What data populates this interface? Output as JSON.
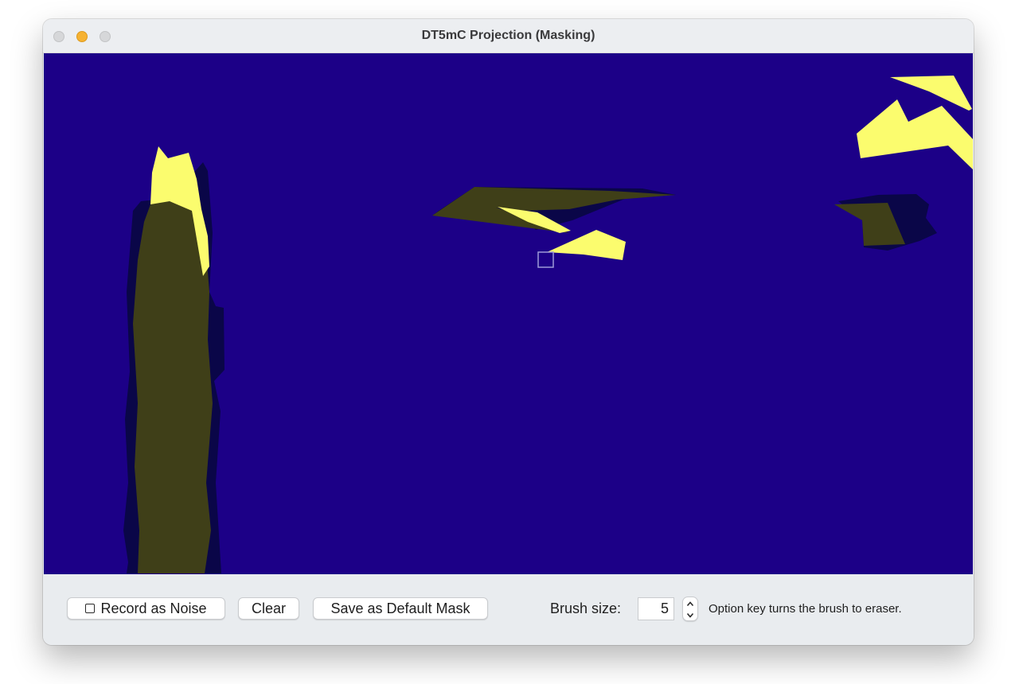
{
  "window": {
    "title": "DT5mC Projection (Masking)"
  },
  "canvas": {
    "background_color": "#1c0087",
    "mask_colors": {
      "highlight": "#fbfc6e",
      "masked": "#3f3f18",
      "shadow": "#0a0648"
    },
    "brush_cursor_icon": "square-outline"
  },
  "toolbar": {
    "record_noise_label": "Record as Noise",
    "record_noise_checked": false,
    "clear_label": "Clear",
    "save_default_label": "Save as Default Mask",
    "brush_size_label": "Brush size:",
    "brush_size_value": "5",
    "hint": "Option key turns the brush to eraser."
  }
}
